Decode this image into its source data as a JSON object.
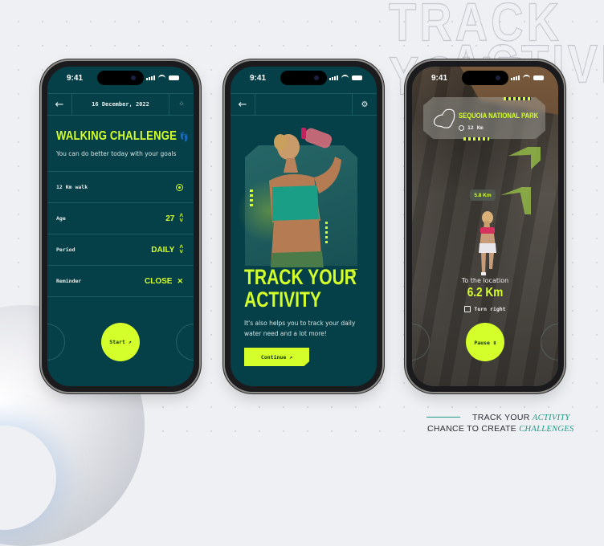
{
  "background": {
    "headline_line1": "TRACK YOUR",
    "headline_line2": "ACTIVITY"
  },
  "colors": {
    "accent": "#d4ff2a",
    "screen_bg": "#053f48",
    "caption_accent": "#1e9a86"
  },
  "status_bar": {
    "time": "9:41"
  },
  "screen1": {
    "back_icon": "arrow-left-icon",
    "date": "16 December, 2022",
    "menu_icon": "grid-dots-icon",
    "title": "WALKING CHALLENGE",
    "title_icon": "footsteps-icon",
    "subtitle": "You can do better today with your goals",
    "rows": [
      {
        "label": "12 Km walk",
        "value": "",
        "icon": "location-pin-icon"
      },
      {
        "label": "Age",
        "value": "27",
        "icon": "chevron-updown-icon"
      },
      {
        "label": "Period",
        "value": "DAILY",
        "icon": "chevron-updown-icon"
      },
      {
        "label": "Reminder",
        "value": "CLOSE",
        "icon": "close-icon"
      }
    ],
    "start_button": "Start ↗"
  },
  "screen2": {
    "back_icon": "arrow-left-icon",
    "settings_icon": "gear-icon",
    "title_line1": "TRACK YOUR",
    "title_line2": "ACTIVITY",
    "description": "It's also helps you to track your daily water need and a lot more!",
    "continue_button": "Continue ↗"
  },
  "screen3": {
    "park_name": "SEQUOIA NATIONAL PARK",
    "park_distance": "12 Km",
    "waypoint_distance": "5.8 Km",
    "to_location_label": "To the location",
    "remaining_distance": "6.2 Km",
    "instruction": "Turn right",
    "pause_button": "Pause ॥"
  },
  "caption": {
    "line1_prefix": "TRACK YOUR",
    "line1_accent": "ACTIVITY",
    "line2_prefix": "CHANCE TO CREATE",
    "line2_accent": "CHALLENGES"
  }
}
